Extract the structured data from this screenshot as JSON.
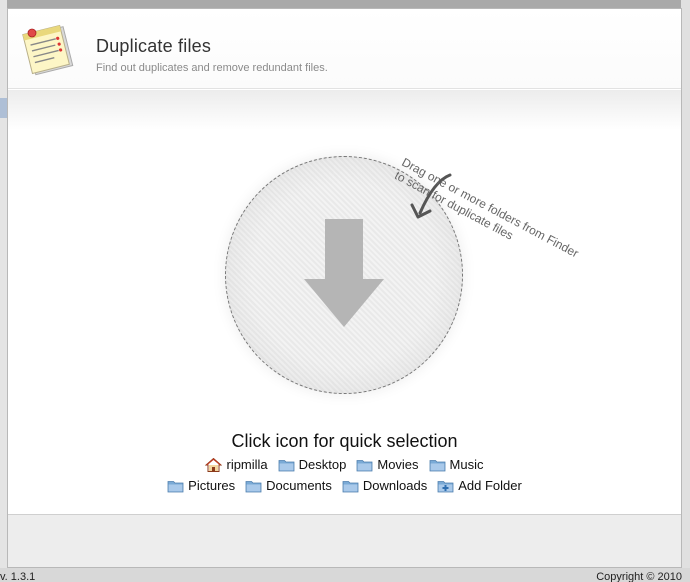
{
  "window": {
    "version_text": "v. 1.3.1",
    "copyright_text": "Copyright © 2010"
  },
  "header": {
    "title": "Duplicate files",
    "subtitle": "Find out duplicates and remove redundant files.",
    "icon": "document-list-icon"
  },
  "dropzone": {
    "hint_line1": "Drag one or more folders from Finder",
    "hint_line2": "to scan for duplicate files",
    "icon": "arrow-down-icon"
  },
  "quick_selection": {
    "title": "Click icon for quick selection",
    "row1": [
      {
        "label": "ripmilla",
        "icon": "home-icon"
      },
      {
        "label": "Desktop",
        "icon": "folder-icon"
      },
      {
        "label": "Movies",
        "icon": "folder-icon"
      },
      {
        "label": "Music",
        "icon": "folder-icon"
      }
    ],
    "row2": [
      {
        "label": "Pictures",
        "icon": "folder-icon"
      },
      {
        "label": "Documents",
        "icon": "folder-icon"
      },
      {
        "label": "Downloads",
        "icon": "folder-icon"
      },
      {
        "label": "Add Folder",
        "icon": "add-folder-icon"
      }
    ]
  },
  "colors": {
    "folder_blue": "#7aaad6",
    "arrow_gray": "#b5b5b5"
  }
}
